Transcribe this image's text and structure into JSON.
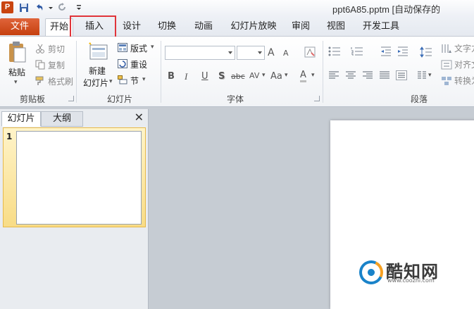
{
  "window": {
    "title": "ppt6A85.pptm [自动保存的"
  },
  "app": {
    "logo_letter": "P"
  },
  "quick_access": [
    {
      "icon": "save-icon"
    },
    {
      "icon": "undo-icon"
    },
    {
      "icon": "redo-icon"
    },
    {
      "icon": "customize-icon"
    }
  ],
  "tabs": {
    "file": "文件",
    "home": "开始",
    "insert": "插入",
    "design": "设计",
    "transitions": "切换",
    "animations": "动画",
    "slideshow": "幻灯片放映",
    "review": "审阅",
    "view": "视图",
    "developer": "开发工具"
  },
  "colors": {
    "file_tab": "#d04d1f",
    "highlight": "#e0343a",
    "selected_thumb": "#f8dc86"
  },
  "ribbon": {
    "clipboard": {
      "label": "剪贴板",
      "paste": "粘贴",
      "cut": "剪切",
      "copy": "复制",
      "format_painter": "格式刷"
    },
    "slides": {
      "label": "幻灯片",
      "new_slide_line1": "新建",
      "new_slide_line2": "幻灯片",
      "layout": "版式",
      "reset": "重设",
      "section": "节"
    },
    "font": {
      "label": "字体",
      "font_name": "",
      "font_size": "",
      "grow": "A",
      "shrink": "A",
      "bold": "B",
      "italic": "I",
      "underline": "U",
      "shadow": "S",
      "strike": "abc",
      "spacing": "AV",
      "case": "Aa",
      "color": "A"
    },
    "paragraph": {
      "label": "段落",
      "text_direction": "文字方",
      "align_text": "对齐文",
      "convert": "转换为"
    }
  },
  "panel": {
    "tab_slides": "幻灯片",
    "tab_outline": "大纲",
    "close": "✕",
    "slide_number": "1"
  },
  "watermark": {
    "name": "酷知网",
    "url": "www.coozhi.com"
  }
}
